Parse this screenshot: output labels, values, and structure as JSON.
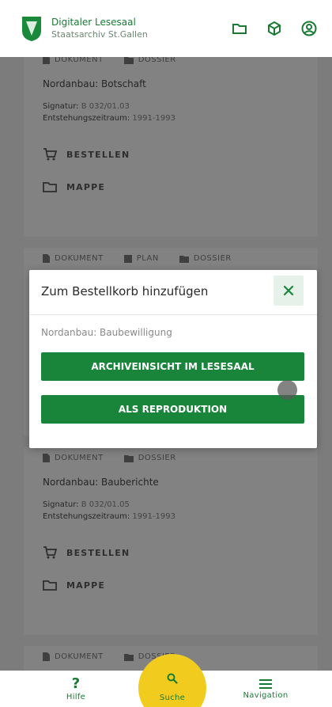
{
  "header": {
    "title": "Digitaler Lesesaal",
    "subtitle": "Staatsarchiv St.Gallen",
    "icons": [
      "folder-icon",
      "cube-icon",
      "user-circle-icon"
    ]
  },
  "cards": [
    {
      "crumbs": [
        "DOKUMENT",
        "DOSSIER"
      ],
      "title": "Nordanbau: Botschaft",
      "signatur_label": "Signatur:",
      "signatur_value": "B 032/01.03",
      "zeitraum_label": "Entstehungszeitraum:",
      "zeitraum_value": "1991-1993",
      "actions": [
        "BESTELLEN",
        "MAPPE"
      ]
    },
    {
      "crumbs": [
        "DOKUMENT",
        "PLAN",
        "DOSSIER"
      ]
    },
    {
      "crumbs": [
        "DOKUMENT",
        "DOSSIER"
      ],
      "title": "Nordanbau: Bauberichte",
      "signatur_label": "Signatur:",
      "signatur_value": "B 032/01.05",
      "zeitraum_label": "Entstehungszeitraum:",
      "zeitraum_value": "1991-1993",
      "actions": [
        "BESTELLEN",
        "MAPPE"
      ]
    },
    {
      "crumbs": [
        "DOKUMENT",
        "DOSSIER"
      ]
    }
  ],
  "modal": {
    "title": "Zum Bestellkorb hinzufügen",
    "subtitle": "Nordanbau: Baubewilligung",
    "button_primary": "ARCHIVEINSICHT IM LESESAAL",
    "button_secondary": "ALS REPRODUKTION"
  },
  "bottom_nav": {
    "help": "Hilfe",
    "search": "Suche",
    "navigation": "Navigation"
  },
  "colors": {
    "brand_green": "#18853a",
    "search_yellow": "#f1cc1e"
  }
}
